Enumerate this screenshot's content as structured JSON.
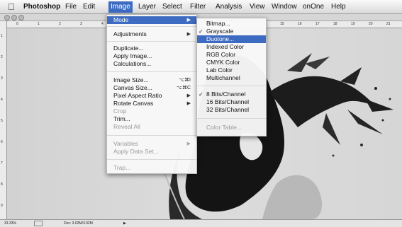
{
  "menubar": {
    "app": "Photoshop",
    "items": [
      "File",
      "Edit",
      "Image",
      "Layer",
      "Select",
      "Filter",
      "Analysis",
      "View",
      "Window",
      "onOne",
      "Help"
    ],
    "active": "Image"
  },
  "image_menu": {
    "items": [
      {
        "label": "Mode",
        "submenu": true,
        "highlighted": true
      },
      {
        "label": "Adjustments",
        "submenu": true
      },
      {
        "label": "Duplicate..."
      },
      {
        "label": "Apply Image..."
      },
      {
        "label": "Calculations..."
      },
      {
        "label": "Image Size...",
        "shortcut": "⌥⌘I"
      },
      {
        "label": "Canvas Size...",
        "shortcut": "⌥⌘C"
      },
      {
        "label": "Pixel Aspect Ratio",
        "submenu": true
      },
      {
        "label": "Rotate Canvas",
        "submenu": true
      },
      {
        "label": "Crop",
        "disabled": true
      },
      {
        "label": "Trim..."
      },
      {
        "label": "Reveal All",
        "disabled": true
      },
      {
        "label": "Variables",
        "submenu": true,
        "disabled": true
      },
      {
        "label": "Apply Data Set...",
        "disabled": true
      },
      {
        "label": "Trap...",
        "disabled": true
      }
    ]
  },
  "mode_menu": {
    "items": [
      {
        "label": "Bitmap..."
      },
      {
        "label": "Grayscale",
        "checked": true
      },
      {
        "label": "Duotone...",
        "highlighted": true
      },
      {
        "label": "Indexed Color"
      },
      {
        "label": "RGB Color"
      },
      {
        "label": "CMYK Color"
      },
      {
        "label": "Lab Color"
      },
      {
        "label": "Multichannel"
      },
      {
        "label": "8 Bits/Channel",
        "checked": true
      },
      {
        "label": "16 Bits/Channel"
      },
      {
        "label": "32 Bits/Channel"
      },
      {
        "label": "Color Table...",
        "disabled": true
      }
    ]
  },
  "ruler_top": [
    "0",
    "1",
    "2",
    "3",
    "4",
    "5",
    "6",
    "7",
    "8",
    "9",
    "15",
    "16",
    "17",
    "18",
    "19",
    "20",
    "21"
  ],
  "ruler_left": [
    "1",
    "2",
    "3",
    "4",
    "5",
    "6",
    "7",
    "8",
    "9"
  ],
  "status": {
    "zoom": "33.33%",
    "doc": "Doc: 3.02M/3.02M",
    "arrow": "▶"
  },
  "icons": {
    "apple": "apple-icon",
    "window_buttons": "traffic-light-icon",
    "checkmark": "checkmark-icon",
    "submenu": "chevron-right-icon"
  },
  "colors": {
    "highlight": "#3d6bc1"
  }
}
